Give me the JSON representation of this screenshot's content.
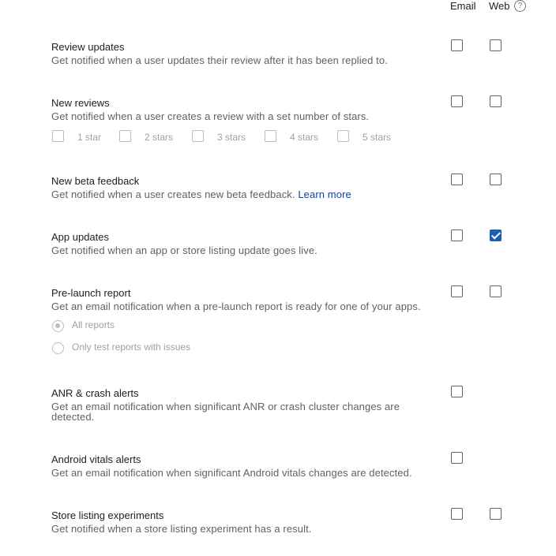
{
  "columns": {
    "email": "Email",
    "web": "Web",
    "help_icon": "?"
  },
  "rows": [
    {
      "title": "Review updates",
      "description": "Get notified when a user updates their review after it has been replied to.",
      "email_checked": false,
      "web_checked": false
    },
    {
      "title": "New reviews",
      "description": "Get notified when a user creates a review with a set number of stars.",
      "email_checked": false,
      "web_checked": false,
      "stars": [
        "1 star",
        "2 stars",
        "3 stars",
        "4 stars",
        "5 stars"
      ]
    },
    {
      "title": "New beta feedback",
      "description": "Get notified when a user creates new beta feedback.",
      "link": "Learn more",
      "email_checked": false,
      "web_checked": false
    },
    {
      "title": "App updates",
      "description": "Get notified when an app or store listing update goes live.",
      "email_checked": false,
      "web_checked": true
    },
    {
      "title": "Pre-launch report",
      "description": "Get an email notification when a pre-launch report is ready for one of your apps.",
      "email_checked": false,
      "web_checked": false,
      "radios": [
        {
          "label": "All reports",
          "selected": true
        },
        {
          "label": "Only test reports with issues",
          "selected": false
        }
      ]
    },
    {
      "title": "ANR & crash alerts",
      "description": "Get an email notification when significant ANR or crash cluster changes are detected.",
      "email_checked": false
    },
    {
      "title": "Android vitals alerts",
      "description": "Get an email notification when significant Android vitals changes are detected.",
      "email_checked": false
    },
    {
      "title": "Store listing experiments",
      "description": "Get notified when a store listing experiment has a result.",
      "email_checked": false,
      "web_checked": false
    }
  ]
}
